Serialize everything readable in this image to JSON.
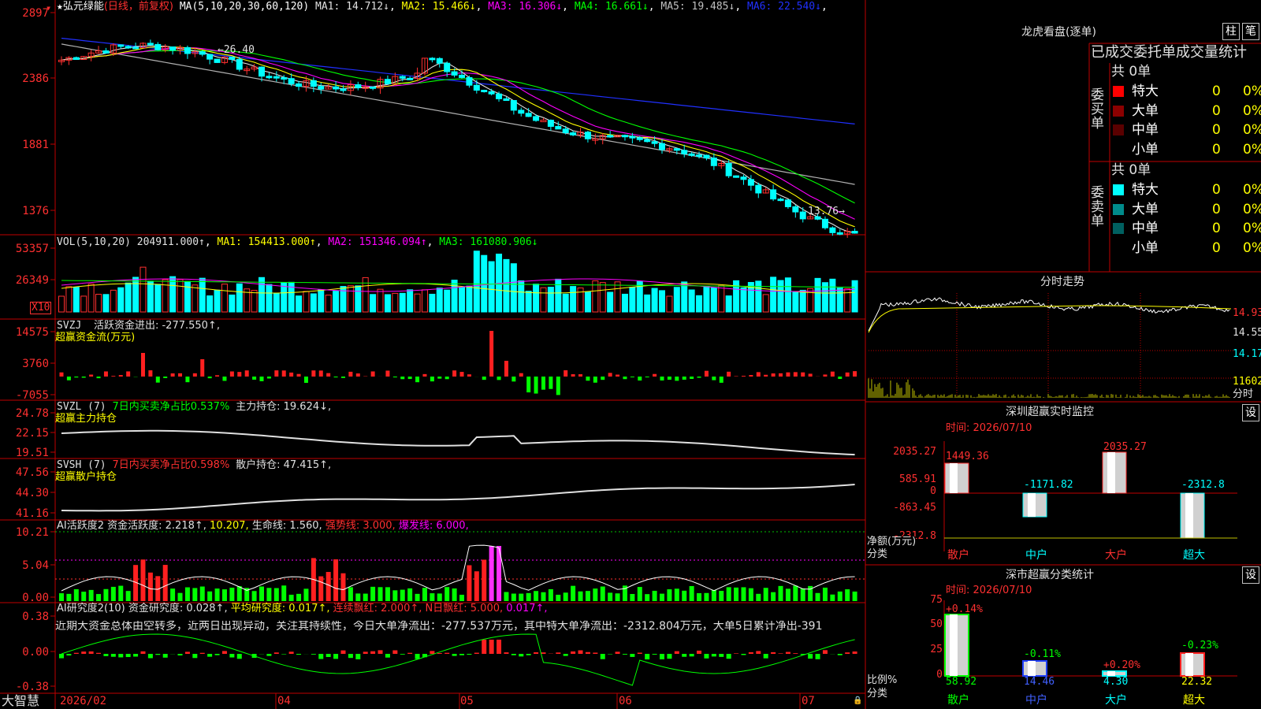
{
  "stock": {
    "star": "★",
    "name": "弘元绿能",
    "period": "(日线，前复权)"
  },
  "ma_line": {
    "label": "MA(5,10,20,30,60,120)",
    "items": [
      {
        "name": "MA1:",
        "value": "14.712↓",
        "color": "#e0e0e0"
      },
      {
        "name": "MA2:",
        "value": "15.466↓",
        "color": "#ffff00"
      },
      {
        "name": "MA3:",
        "value": "16.306↓",
        "color": "#ff00ff"
      },
      {
        "name": "MA4:",
        "value": "16.661↓",
        "color": "#00ff00"
      },
      {
        "name": "MA5:",
        "value": "19.485↓",
        "color": "#c0c0c0"
      },
      {
        "name": "MA6:",
        "value": "22.540↓",
        "color": "#2030ff"
      }
    ]
  },
  "price_axis": [
    "2897",
    "2386",
    "1881",
    "1376"
  ],
  "price_annotations": {
    "high": "26.40",
    "low": "13.76"
  },
  "vol": {
    "label": "VOL(5,10,20)",
    "value": "204911.000↑",
    "ma1": "MA1: 154413.000↑",
    "ma2": "MA2: 151346.094↑",
    "ma3": "MA3: 161080.906↓",
    "axis": [
      "53357",
      "26349"
    ],
    "unit": "X10"
  },
  "svzj": {
    "label": "SVZJ",
    "title": "活跃资金进出: -277.550↑,",
    "subtitle": "超赢资金流(万元)",
    "axis": [
      "14575",
      "3760",
      "-7055"
    ]
  },
  "svzl": {
    "label": "SVZL (7)",
    "ratio": "7日内买卖净占比0.537%",
    "hold": "主力持仓: 19.624↓,",
    "subtitle": "超赢主力持仓",
    "axis": [
      "24.78",
      "22.15",
      "19.51"
    ]
  },
  "svsh": {
    "label": "SVSH (7)",
    "ratio": "7日内买卖净占比0.598%",
    "hold": "散户持仓: 47.415↑,",
    "subtitle": "超赢散户持仓",
    "axis": [
      "47.56",
      "44.30",
      "41.16"
    ]
  },
  "ai2": {
    "label": "AI活跃度2",
    "a": "资金活跃度: 2.218↑,",
    "b": "10.207,",
    "c": "生命线: 1.560,",
    "d": "强势线: 3.000,",
    "e": "爆发线: 6.000,",
    "axis": [
      "10.21",
      "5.04",
      "0.00"
    ]
  },
  "ai_research": {
    "label": "AI研究度2(10)",
    "a": "资金研究度: 0.028↑,",
    "b": "平均研究度: 0.017↑,",
    "c": "连续飘红: 2.000↑,",
    "d": "N日飘红: 5.000,",
    "e": "0.017↑,",
    "comment": "近期大资金总体由空转多，近两日出现异动，关注其持续性，今日大单净流出：-277.537万元，其中特大单净流出：-2312.804万元，大单5日累计净出-391",
    "axis": [
      "0.38",
      "0.00",
      "-0.38"
    ]
  },
  "bottom": {
    "logo": "大智慧",
    "dates": [
      "2026/02",
      "04",
      "05",
      "06",
      "07"
    ]
  },
  "lhb": {
    "title": "龙虎看盘(逐单)",
    "btn_bar": "柱",
    "btn_pen": "笔",
    "header": "已成交委托单成交量统计",
    "buy": {
      "side": "委买单",
      "total": "共 0单",
      "rows": [
        {
          "n": "特大",
          "v": "0",
          "p": "0%",
          "c": "#ff0000"
        },
        {
          "n": "大单",
          "v": "0",
          "p": "0%",
          "c": "#8b0000"
        },
        {
          "n": "中单",
          "v": "0",
          "p": "0%",
          "c": "#5a0000"
        },
        {
          "n": "小单",
          "v": "0",
          "p": "0%",
          "c": ""
        }
      ]
    },
    "sell": {
      "side": "委卖单",
      "total": "共 0单",
      "rows": [
        {
          "n": "特大",
          "v": "0",
          "p": "0%",
          "c": "#00ffff"
        },
        {
          "n": "大单",
          "v": "0",
          "p": "0%",
          "c": "#008b8b"
        },
        {
          "n": "中单",
          "v": "0",
          "p": "0%",
          "c": "#006060"
        },
        {
          "n": "小单",
          "v": "0",
          "p": "0%",
          "c": ""
        }
      ]
    }
  },
  "intraday": {
    "title": "分时走势",
    "axis": [
      "14.93",
      "14.55",
      "14.17",
      "11602"
    ],
    "unit": "分时"
  },
  "sz_monitor": {
    "title": "深圳超赢实时监控",
    "btn": "设",
    "time": "时间: 2026/07/10",
    "axis": [
      "2035.27",
      "585.91",
      "0",
      "-863.45",
      "-2312.8"
    ],
    "ylabel": "净额(万元)",
    "xlabel": "分类",
    "bars": [
      {
        "cat": "散户",
        "value": "1449.36"
      },
      {
        "cat": "中户",
        "value": "-1171.82"
      },
      {
        "cat": "大户",
        "value": "2035.27"
      },
      {
        "cat": "超大",
        "value": "-2312.8"
      }
    ]
  },
  "sz_classify": {
    "title": "深市超赢分类统计",
    "btn": "设",
    "time": "时间: 2026/07/10",
    "axis": [
      "75",
      "50",
      "25",
      "0"
    ],
    "ylabel": "比例%",
    "xlabel": "分类",
    "bars": [
      {
        "cat": "散户",
        "pct": "58.92",
        "chg": "+0.14%"
      },
      {
        "cat": "中户",
        "pct": "14.46",
        "chg": "-0.11%"
      },
      {
        "cat": "大户",
        "pct": "4.30",
        "chg": "+0.20%"
      },
      {
        "cat": "超大",
        "pct": "22.32",
        "chg": "-0.23%"
      }
    ]
  }
}
